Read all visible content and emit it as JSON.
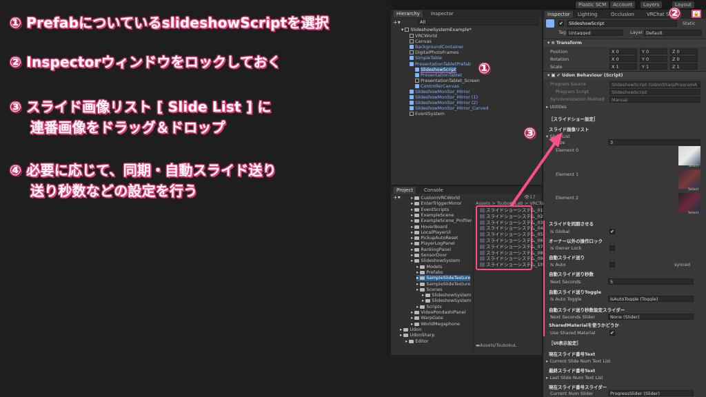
{
  "steps": [
    "① PrefabについているslideshowScriptを選択",
    "② Inspectorウィンドウをロックしておく",
    "③ スライド画像リスト [ Slide List ] に",
    "連番画像をドラッグ＆ドロップ",
    "④ 必要に応じて、同期・自動スライド送り",
    "送り秒数などの設定を行う"
  ],
  "toolbar": {
    "plastic": "Plastic SCM",
    "account": "Account",
    "layers": "Layers",
    "layout": "Layout"
  },
  "hierarchy": {
    "tabs": [
      "Hierarchy",
      "Inspector"
    ],
    "search": "All",
    "root": "SlideshowSystemExample*",
    "items": [
      {
        "label": "VRCWorld",
        "type": "go",
        "indent": 1
      },
      {
        "label": "Canvas",
        "type": "go",
        "indent": 1
      },
      {
        "label": "BackgroundContainer",
        "type": "prefab",
        "indent": 1
      },
      {
        "label": "DigitalPhotoFrames",
        "type": "go",
        "indent": 1
      },
      {
        "label": "SimpleTable",
        "type": "prefab",
        "indent": 1
      },
      {
        "label": "PresentationTabletPrefab",
        "type": "prefab",
        "indent": 1
      },
      {
        "label": "SlideshowScript",
        "type": "sel",
        "indent": 2
      },
      {
        "label": "PresentationTablet",
        "type": "prefab",
        "indent": 2
      },
      {
        "label": "PresentationTablet_Screen",
        "type": "go",
        "indent": 2
      },
      {
        "label": "ControllerCanvas",
        "type": "prefab",
        "indent": 2
      },
      {
        "label": "SlideshowMonitor_Mirror",
        "type": "prefab",
        "indent": 1
      },
      {
        "label": "SlideshowMonitor_Mirror (1)",
        "type": "prefab",
        "indent": 1
      },
      {
        "label": "SlideshowMonitor_Mirror (2)",
        "type": "prefab",
        "indent": 1
      },
      {
        "label": "SlideshowMonitor_Mirror_Curved",
        "type": "prefab",
        "indent": 1
      },
      {
        "label": "EventSystem",
        "type": "go",
        "indent": 1
      }
    ]
  },
  "project": {
    "tabs": [
      "Project",
      "Console"
    ],
    "breadcrumb": "Assets > TsubokuLab > VRCTo",
    "count": "17",
    "tree": [
      {
        "label": "CustomVRCWorld",
        "indent": 3
      },
      {
        "label": "EnterTriggerMirror",
        "indent": 3
      },
      {
        "label": "EventScripts",
        "indent": 3
      },
      {
        "label": "ExampleScene",
        "indent": 3
      },
      {
        "label": "ExampleScene_Profiler",
        "indent": 3
      },
      {
        "label": "HoverBoard",
        "indent": 3
      },
      {
        "label": "LocalPlayerUI",
        "indent": 3
      },
      {
        "label": "PickupAutoReset",
        "indent": 3
      },
      {
        "label": "PlayerLogPanel",
        "indent": 3
      },
      {
        "label": "RankingPanel",
        "indent": 3
      },
      {
        "label": "SensorDoor",
        "indent": 3
      },
      {
        "label": "SlideshowSystem",
        "indent": 3
      },
      {
        "label": "Models",
        "indent": 4
      },
      {
        "label": "Prefabs",
        "indent": 4
      },
      {
        "label": "SampleSlideTexture",
        "indent": 4,
        "sel": true
      },
      {
        "label": "SampleSlideTexture",
        "indent": 4
      },
      {
        "label": "Scenes",
        "indent": 4
      },
      {
        "label": "SlideshowSystem",
        "indent": 5
      },
      {
        "label": "SlideshowSystem",
        "indent": 5
      },
      {
        "label": "Scripts",
        "indent": 4
      },
      {
        "label": "VideoPondashiPanel",
        "indent": 3
      },
      {
        "label": "WarpGate",
        "indent": 3
      },
      {
        "label": "WorldMegaphone",
        "indent": 3
      },
      {
        "label": "Udon",
        "indent": 1
      },
      {
        "label": "UdonSharp",
        "indent": 1
      },
      {
        "label": "Editor",
        "indent": 2
      }
    ],
    "files": [
      "スライドショーシステム_01",
      "スライドショーシステム_02",
      "スライドショーシステム_03",
      "スライドショーシステム_04",
      "スライドショーシステム_05",
      "スライドショーシステム_06",
      "スライドショーシステム_07",
      "スライドショーシステム_08",
      "スライドショーシステム_09",
      "スライドショーシステム_10"
    ],
    "footer": "Assets/TsubokuL"
  },
  "inspector": {
    "tabs": [
      "Inspector",
      "Lighting",
      "Occlusion",
      "VRChat SD"
    ],
    "object": "SlideshowScript",
    "static": "Static",
    "tag_label": "Tag",
    "tag": "Untagged",
    "layer_label": "Layer",
    "layer": "Default",
    "transform": "Transform",
    "position": "Position",
    "rotation": "Rotation",
    "scale": "Scale",
    "pos": [
      "X 0",
      "Y 0",
      "Z 0"
    ],
    "rot": [
      "X 0",
      "Y 0",
      "Z 0"
    ],
    "scl": [
      "X 1",
      "Y 1",
      "Z 1"
    ],
    "udon": "Udon Behaviour (Script)",
    "program_source": "Program Source",
    "program_source_val": "SlideshowScript (UdonSharpProgramA",
    "program_script": "Program Script",
    "program_script_val": "SlideshowScript",
    "sync_method": "Synchronization Method",
    "sync_method_val": "Manual",
    "utilities": "Utilities",
    "section_settings": "［スライドショー設定］",
    "slide_list_jp": "スライド画像リスト",
    "slide_list": "Slide List",
    "size": "Size",
    "size_val": "3",
    "elements": [
      "Element 0",
      "Element 1",
      "Element 2"
    ],
    "select": "Select",
    "sync_jp": "スライドを同期させる",
    "is_global": "Is Global",
    "owner_jp": "オーナー以外の操作ロック",
    "is_owner_lock": "Is Owner Lock",
    "auto_jp": "自動スライド送り",
    "is_auto": "Is Auto",
    "synced": "synced",
    "seconds_jp": "自動スライド送り秒数",
    "next_seconds": "Next Seconds",
    "next_seconds_val": "5",
    "toggle_jp": "自動スライド送りToggle",
    "is_auto_toggle": "Is Auto Toggle",
    "is_auto_toggle_val": "IsAutoToggle (Toggle)",
    "slider_jp": "自動スライド送り秒数設定スライダー",
    "next_seconds_slider": "Next Seconds Slider",
    "next_seconds_slider_val": "None (Slider)",
    "shared_jp": "SharedMaterialを使うかどうか",
    "use_shared": "Use Shared Material",
    "ui_section": "［UI表示設定］",
    "cur_num_jp": "現在スライド番号Text",
    "cur_num": "Current Slide Num Text List",
    "last_num_jp": "最終スライド番号Text",
    "last_num": "Last Slide Num Text List",
    "slider_cur_jp": "現在スライド番号スライダー",
    "cur_num_slider": "Current Num Slider",
    "cur_num_slider_val": "ProgressSlider (Slider)"
  },
  "markers": {
    "one": "①",
    "two": "②",
    "three": "③"
  },
  "colors": {
    "accent": "#ff4f87",
    "selection": "#2c5d87",
    "prefab": "#7fb2ff"
  }
}
